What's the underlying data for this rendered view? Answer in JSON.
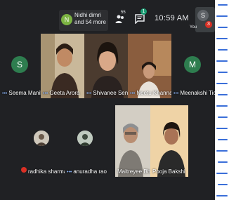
{
  "notification": {
    "avatar_letter": "N",
    "text": "Nidhi dimri and 54 more"
  },
  "toolbar": {
    "people_count": "55",
    "chat_badge": "1",
    "time": "10:59 AM"
  },
  "self_view": {
    "letter": "S",
    "label": "You",
    "badge": "3"
  },
  "participants": [
    {
      "name": "Seema Manikl...",
      "letter": "S"
    },
    {
      "name": "Geeta Arora"
    },
    {
      "name": "Shivanee Sen"
    },
    {
      "name": "Neetu Khanna"
    },
    {
      "name": "Meenakshi Tic...",
      "letter": "M"
    },
    {
      "name": "radhika sharma"
    },
    {
      "name": "anuradha rao"
    },
    {
      "name": "Maitreyee Bhat..."
    },
    {
      "name": "Pooja Bakshi"
    }
  ],
  "colors": {
    "background": "#202124",
    "accent_dots": "#8ab4f8",
    "avatar_green": "#2e7d4f",
    "mic_off": "#d93025"
  }
}
